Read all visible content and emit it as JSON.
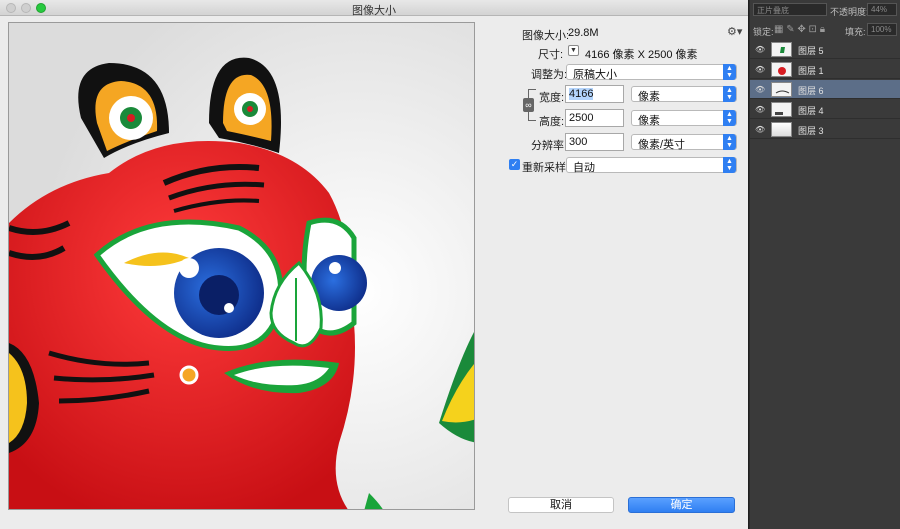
{
  "dialog": {
    "title": "图像大小",
    "image_size_label": "图像大小:",
    "image_size_value": "29.8M",
    "dimensions_label": "尺寸:",
    "dimensions_value": "4166 像素  X  2500 像素",
    "fit_to_label": "调整为:",
    "fit_to_value": "原稿大小",
    "width_label": "宽度:",
    "width_value": "4166",
    "width_unit": "像素",
    "height_label": "高度:",
    "height_value": "2500",
    "height_unit": "像素",
    "resolution_label": "分辨率:",
    "resolution_value": "300",
    "resolution_unit": "像素/英寸",
    "resample_label": "重新采样:",
    "resample_checked": true,
    "resample_value": "自动",
    "cancel_label": "取消",
    "ok_label": "确定"
  },
  "panel": {
    "blend_mode": "正片叠底",
    "opacity_label": "不透明度:",
    "opacity_value": "44%",
    "lock_label": "锁定:",
    "fill_label": "填充:",
    "fill_value": "100%",
    "layers": [
      {
        "name": "图层 5",
        "active": false
      },
      {
        "name": "图层 1",
        "active": false
      },
      {
        "name": "图层 6",
        "active": true
      },
      {
        "name": "图层 4",
        "active": false
      },
      {
        "name": "图层 3",
        "active": false
      }
    ]
  }
}
